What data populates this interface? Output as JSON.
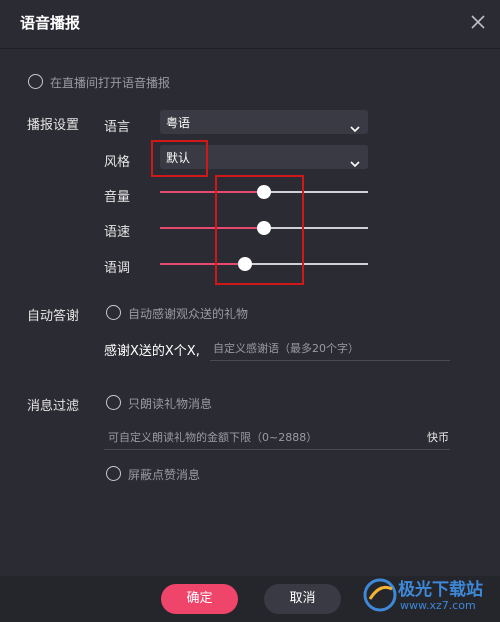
{
  "dialog": {
    "title": "语音播报"
  },
  "live_room_option": {
    "label": "在直播间打开语音播报",
    "checked": false
  },
  "broadcast_settings": {
    "section_label": "播报设置",
    "language": {
      "label": "语言",
      "value": "粤语"
    },
    "style": {
      "label": "风格",
      "value": "默认"
    },
    "volume": {
      "label": "音量",
      "level_percent": 50
    },
    "speed": {
      "label": "语速",
      "level_percent": 50
    },
    "pitch": {
      "label": "语调",
      "level_percent": 41
    }
  },
  "auto_thanks": {
    "section_label": "自动答谢",
    "option_label": "自动感谢观众送的礼物",
    "checked": false,
    "prefix": "感谢X送的X个X,",
    "input_placeholder": "自定义感谢语（最多20个字）"
  },
  "message_filter": {
    "section_label": "消息过滤",
    "gift_only_label": "只朗读礼物消息",
    "gift_only_checked": false,
    "amount_placeholder": "可自定义朗读礼物的金额下限（0~2888）",
    "amount_unit": "快币",
    "block_likes_label": "屏蔽点赞消息",
    "block_likes_checked": false
  },
  "footer": {
    "confirm_label": "确定",
    "cancel_label": "取消"
  },
  "watermark": {
    "brand": "极光下载站",
    "url": "www.xz7.com"
  },
  "colors": {
    "accent": "#f0456a",
    "highlight_box": "#d01818",
    "background": "#2b2b33"
  }
}
